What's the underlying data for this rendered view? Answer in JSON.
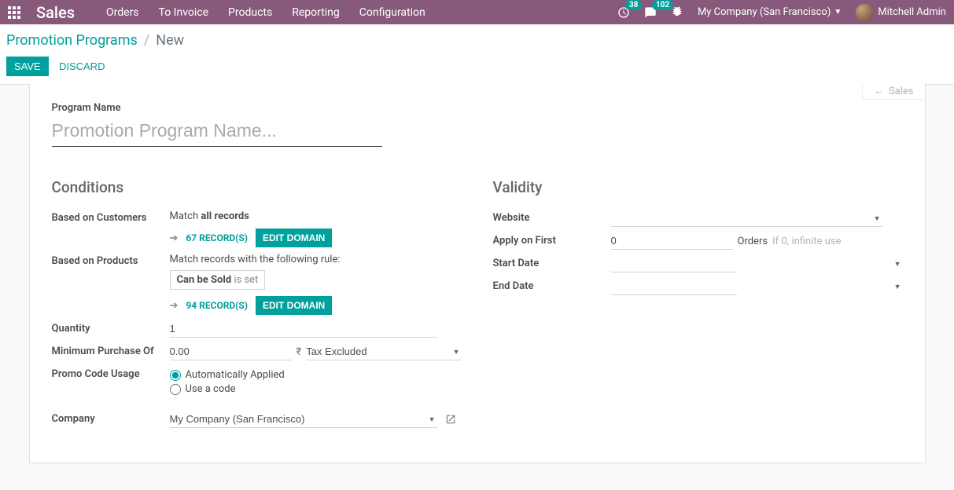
{
  "nav": {
    "brand": "Sales",
    "menu": [
      "Orders",
      "To Invoice",
      "Products",
      "Reporting",
      "Configuration"
    ],
    "badge_clock": "38",
    "badge_chat": "102",
    "company": "My Company (San Francisco)",
    "user": "Mitchell Admin"
  },
  "breadcrumb": {
    "root": "Promotion Programs",
    "current": "New"
  },
  "actions": {
    "save": "Save",
    "discard": "Discard"
  },
  "status_hint": "Sales",
  "program_name": {
    "label": "Program Name",
    "placeholder": "Promotion Program Name...",
    "value": ""
  },
  "sections": {
    "conditions": "Conditions",
    "validity": "Validity"
  },
  "conditions": {
    "customers_label": "Based on Customers",
    "customers_match_prefix": "Match ",
    "customers_match_bold": "all records",
    "customers_records": "67 RECORD(S)",
    "edit_domain": "EDIT DOMAIN",
    "products_label": "Based on Products",
    "products_match_text": "Match records with the following rule:",
    "products_rule_field": "Can be Sold",
    "products_rule_cond": " is set",
    "products_records": "94 RECORD(S)",
    "quantity_label": "Quantity",
    "quantity_value": "1",
    "min_purchase_label": "Minimum Purchase Of",
    "min_purchase_value": "0.00",
    "currency": "₹",
    "tax_option": "Tax Excluded",
    "promo_label": "Promo Code Usage",
    "promo_auto": "Automatically Applied",
    "promo_code": "Use a code",
    "company_label": "Company",
    "company_value": "My Company (San Francisco)"
  },
  "validity": {
    "website_label": "Website",
    "website_value": "",
    "apply_first_label": "Apply on First",
    "apply_first_value": "0",
    "apply_first_unit": "Orders",
    "apply_first_hint": "If 0, infinite use",
    "start_date_label": "Start Date",
    "start_date_value": "",
    "end_date_label": "End Date",
    "end_date_value": ""
  }
}
